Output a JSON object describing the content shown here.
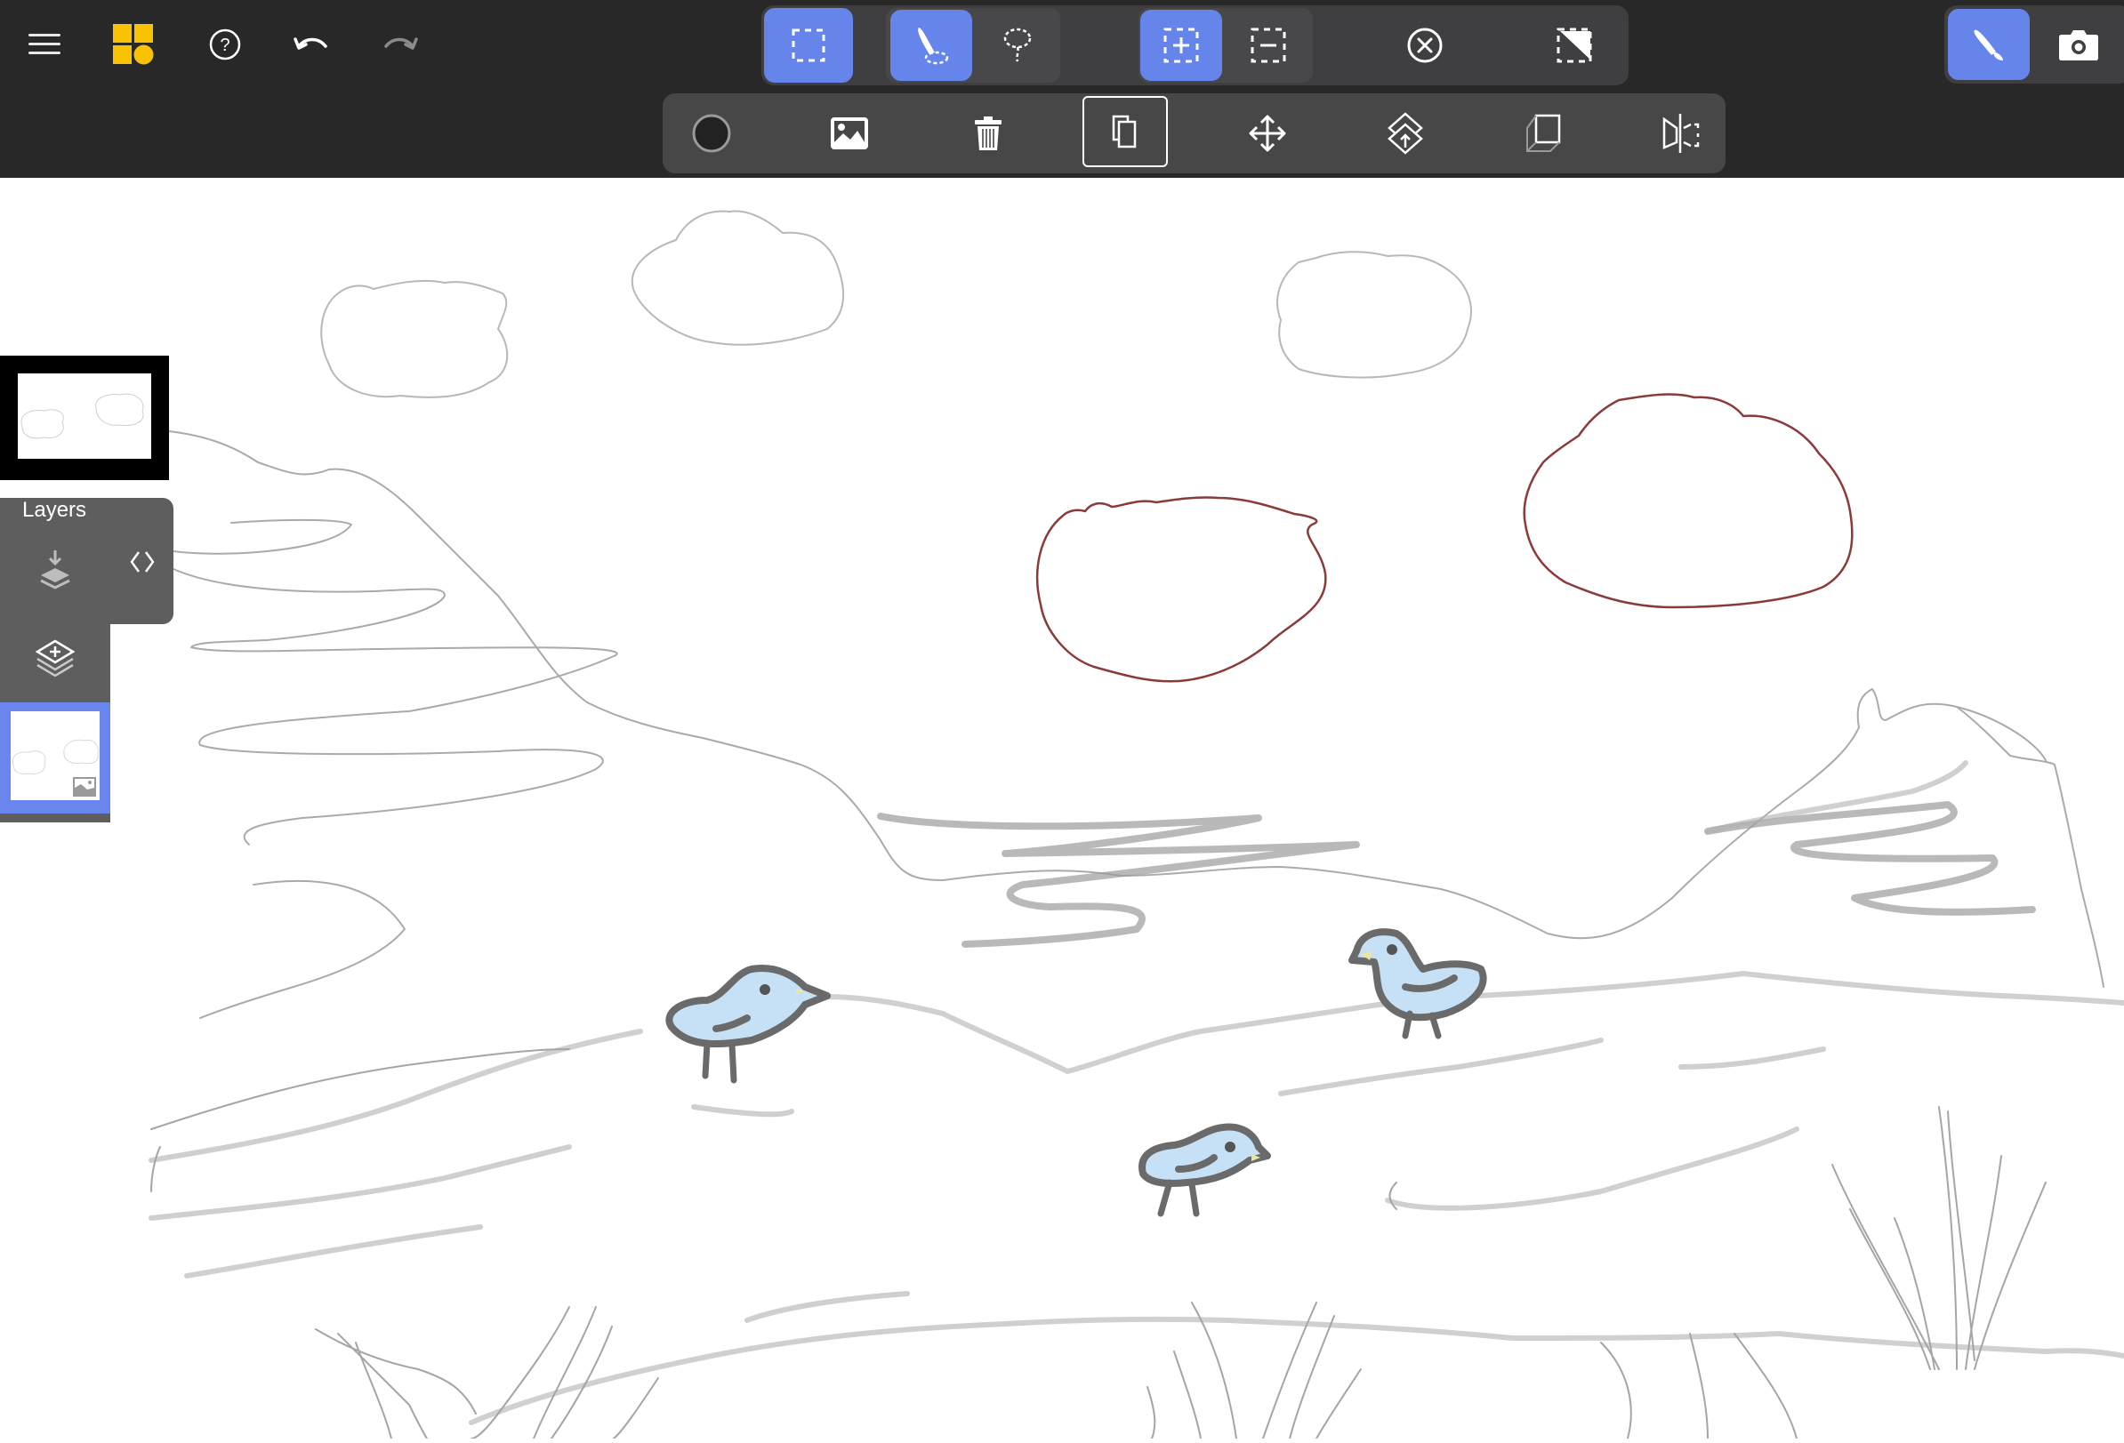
{
  "app": {
    "left_toolbar": [
      {
        "name": "menu",
        "icon": "hamburger-menu-icon"
      },
      {
        "name": "apps",
        "icon": "app-logo-icon",
        "color": "#f9c203"
      },
      {
        "name": "help",
        "icon": "help-icon"
      },
      {
        "name": "undo",
        "icon": "undo-icon",
        "enabled": true
      },
      {
        "name": "redo",
        "icon": "redo-icon",
        "enabled": false
      }
    ],
    "selection_toolbar": [
      {
        "name": "rectangle-select",
        "icon": "dashed-rectangle-icon",
        "active": true
      },
      {
        "name": "brush-select",
        "icon": "brush-select-icon",
        "active": true
      },
      {
        "name": "lasso-select",
        "icon": "lasso-icon",
        "active": false
      },
      {
        "name": "add-to-selection",
        "icon": "selection-add-icon",
        "active": true
      },
      {
        "name": "subtract-from-selection",
        "icon": "selection-subtract-icon",
        "active": false
      },
      {
        "name": "clear-selection",
        "icon": "close-circle-icon",
        "active": false
      },
      {
        "name": "invert-selection",
        "icon": "invert-selection-icon",
        "active": false
      }
    ],
    "action_toolbar": [
      {
        "name": "color",
        "icon": "color-swatch-icon",
        "value": "#222222"
      },
      {
        "name": "insert-image",
        "icon": "image-icon"
      },
      {
        "name": "delete",
        "icon": "trash-icon"
      },
      {
        "name": "duplicate",
        "icon": "duplicate-icon",
        "active": true
      },
      {
        "name": "move",
        "icon": "move-arrows-icon"
      },
      {
        "name": "move-to-layer",
        "icon": "layer-move-icon"
      },
      {
        "name": "skew",
        "icon": "skew-icon"
      },
      {
        "name": "flip-horizontal",
        "icon": "flip-horizontal-icon"
      }
    ],
    "mode_toolbar": [
      {
        "name": "draw-mode",
        "icon": "brush-icon",
        "active": true
      },
      {
        "name": "camera",
        "icon": "camera-icon",
        "active": false
      }
    ],
    "layers": {
      "title": "Layers",
      "merge_down_icon": "merge-layer-down-icon",
      "expand_icon": "expand-collapse-icon",
      "add_layer_icon": "add-layer-icon",
      "items": [
        {
          "name": "layer-1",
          "type_icon": "image-icon",
          "selected": true
        }
      ]
    },
    "colors": {
      "accent": "#6585ea",
      "toolbar_bg": "#282828",
      "group_bg": "#3f3f41",
      "panel_bg": "#5e5e5e",
      "sketch_gray": "#9a9a9a",
      "cloud_red": "#8b3a3a",
      "bird_blue": "#c6e0f5",
      "bird_outline": "#6a6a6a"
    }
  }
}
